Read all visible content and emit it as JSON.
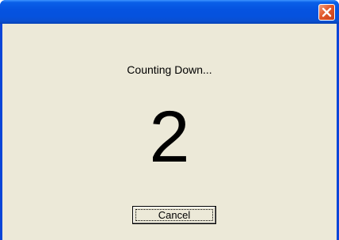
{
  "window": {
    "title": "",
    "close_icon": "close-x-icon"
  },
  "dialog": {
    "label": "Counting Down...",
    "count": "2"
  },
  "buttons": {
    "cancel_label": "Cancel"
  },
  "colors": {
    "titlebar": "#0553e0",
    "client_bg": "#ece9d8",
    "close_button": "#e2582a"
  }
}
